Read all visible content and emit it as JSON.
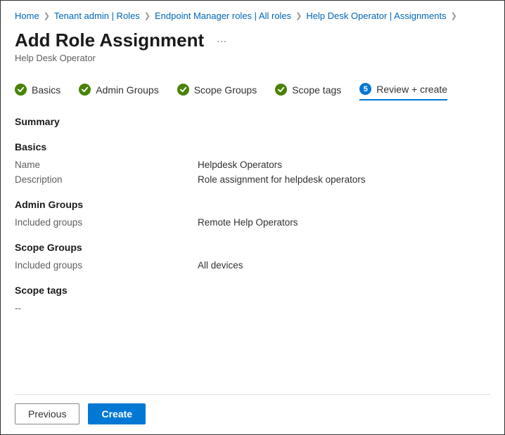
{
  "breadcrumbs": {
    "items": [
      {
        "label": "Home"
      },
      {
        "label": "Tenant admin | Roles"
      },
      {
        "label": "Endpoint Manager roles | All roles"
      },
      {
        "label": "Help Desk Operator | Assignments"
      }
    ]
  },
  "header": {
    "title": "Add Role Assignment",
    "subtitle": "Help Desk Operator"
  },
  "tabs": [
    {
      "label": "Basics",
      "state": "done"
    },
    {
      "label": "Admin Groups",
      "state": "done"
    },
    {
      "label": "Scope Groups",
      "state": "done"
    },
    {
      "label": "Scope tags",
      "state": "done"
    },
    {
      "label": "Review + create",
      "state": "active",
      "number": "5"
    }
  ],
  "summary": {
    "heading": "Summary",
    "sections": {
      "basics": {
        "title": "Basics",
        "name_label": "Name",
        "name_value": "Helpdesk Operators",
        "desc_label": "Description",
        "desc_value": "Role assignment for helpdesk operators"
      },
      "admin_groups": {
        "title": "Admin Groups",
        "included_label": "Included groups",
        "included_value": "Remote Help Operators"
      },
      "scope_groups": {
        "title": "Scope Groups",
        "included_label": "Included groups",
        "included_value": "All devices"
      },
      "scope_tags": {
        "title": "Scope tags",
        "value": "--"
      }
    }
  },
  "footer": {
    "previous": "Previous",
    "create": "Create"
  }
}
